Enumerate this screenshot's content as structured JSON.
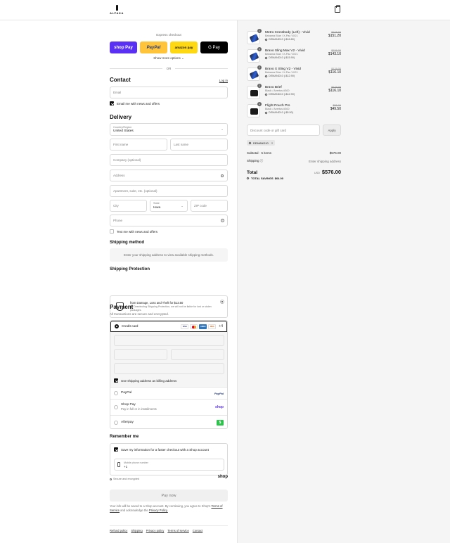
{
  "header": {
    "logo_text": "ALPAKA",
    "cart_icon": "shopping-bag-icon"
  },
  "express": {
    "title": "Express checkout",
    "buttons": [
      "shop Pay",
      "PayPal",
      "amazon pay",
      "G Pay"
    ],
    "show_more": "Show more options ⌄",
    "or": "OR"
  },
  "contact": {
    "title": "Contact",
    "login": "Log in",
    "email_placeholder": "Email",
    "news_label": "Email me with news and offers",
    "news_checked": true
  },
  "delivery": {
    "title": "Delivery",
    "country_label": "Country/Region",
    "country_value": "United States",
    "first_name": "First name",
    "last_name": "Last name",
    "company": "Company (optional)",
    "address": "Address",
    "apartment": "Apartment, suite, etc. (optional)",
    "city": "City",
    "state_label": "State",
    "state_value": "Iowa",
    "zip": "ZIP code",
    "phone": "Phone",
    "text_label": "Text me with news and offers",
    "text_checked": false
  },
  "shipping_method": {
    "title": "Shipping method",
    "message": "Enter your shipping address to view available shipping methods."
  },
  "protection": {
    "title": "Shipping Protection",
    "line1": "from Damage, Loss and Theft for $13.50",
    "line2": "By Deselecting Shipping Protection, we will not be liable for lost or stolen packages."
  },
  "payment": {
    "title": "Payment",
    "subtitle": "All transactions are secure and encrypted.",
    "credit_card": "Credit card",
    "card_logos": [
      "VISA",
      "mastercard",
      "AMEX",
      "DISCOVER"
    ],
    "more_cards": "+4",
    "billing_label": "Use shipping address as billing address",
    "billing_checked": true,
    "options": [
      {
        "label": "PayPal",
        "sub": "",
        "logo": "PayPal"
      },
      {
        "label": "Shop Pay",
        "sub": "Pay in full or in installments",
        "logo": "shop"
      },
      {
        "label": "Afterpay",
        "sub": "",
        "logo": "$"
      }
    ]
  },
  "remember": {
    "title": "Remember me",
    "save_label": "Save my information for a faster checkout with a Shop account",
    "save_checked": true,
    "phone_label": "Mobile phone number",
    "phone_value": "+1",
    "secure": "Secure and encrypted",
    "shop_mark": "shop"
  },
  "pay_now": "Pay now",
  "legal": {
    "text1": "Your info will be saved to a Shop account. By continuing, you agree to Shop's",
    "terms": "Terms of Service",
    "and": "and acknowledge the",
    "privacy": "Privacy Policy."
  },
  "footer": [
    "Refund policy",
    "Shipping",
    "Privacy policy",
    "Terms of service",
    "Contact"
  ],
  "order": {
    "items": [
      {
        "qty": "1",
        "name": "Metro Crossbody (Left) - Vivid",
        "variant": "Bahama Blue / X-Pac VX21",
        "discount": "DEMAND10 (-$16.80)",
        "old": "$168.00",
        "new": "$151.20",
        "color": "blue"
      },
      {
        "qty": "1",
        "name": "Bravo Sling Max V2 - Vivid",
        "variant": "Bahama Blue / X-Pac VX21",
        "discount": "DEMAND10 (-$15.90)",
        "old": "$159.00",
        "new": "$143.10",
        "color": "blue"
      },
      {
        "qty": "1",
        "name": "Bravo X Sling V2 - Vivid",
        "variant": "Bahama Blue / X-Pac VX21",
        "discount": "DEMAND10 (-$12.90)",
        "old": "$129.00",
        "new": "$116.10",
        "color": "blue"
      },
      {
        "qty": "1",
        "name": "Bravo Brief",
        "variant": "Black / Avertus #300",
        "discount": "DEMAND10 (-$12.90)",
        "old": "$129.00",
        "new": "$116.10",
        "color": "black"
      },
      {
        "qty": "1",
        "name": "Flight Pouch Pro",
        "variant": "Black / Avertus #300",
        "discount": "DEMAND10 (-$5.50)",
        "old": "$55.00",
        "new": "$49.50",
        "color": "black"
      }
    ],
    "discount_placeholder": "Discount code or gift card",
    "apply": "Apply",
    "chip": "DEMAND10",
    "subtotal_label": "Subtotal · 5 items",
    "subtotal_value": "$576.00",
    "shipping_label": "Shipping",
    "shipping_value": "Enter shipping address",
    "total_label": "Total",
    "currency": "USD",
    "total_value": "$576.00",
    "savings_label": "TOTAL SAVINGS",
    "savings_value": "$64.00"
  }
}
